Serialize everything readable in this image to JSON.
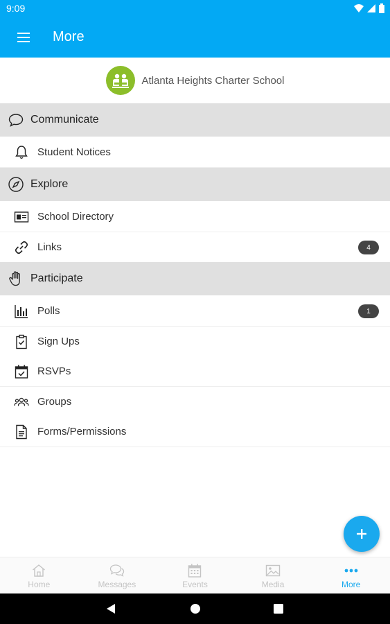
{
  "status_bar": {
    "time": "9:09"
  },
  "app_bar": {
    "title": "More"
  },
  "school": {
    "name": "Atlanta Heights Charter School",
    "logo_color": "#8cbe2a"
  },
  "sections": {
    "communicate": {
      "label": "Communicate",
      "items": [
        {
          "label": "Student Notices"
        }
      ]
    },
    "explore": {
      "label": "Explore",
      "items": [
        {
          "label": "School Directory"
        },
        {
          "label": "Links",
          "badge": "4"
        }
      ]
    },
    "participate": {
      "label": "Participate",
      "items": [
        {
          "label": "Polls",
          "badge": "1"
        },
        {
          "label": "Sign Ups"
        },
        {
          "label": "RSVPs"
        },
        {
          "label": "Groups"
        },
        {
          "label": "Forms/Permissions"
        }
      ]
    }
  },
  "bottom_nav": {
    "items": [
      {
        "label": "Home",
        "icon": "home-icon"
      },
      {
        "label": "Messages",
        "icon": "messages-icon"
      },
      {
        "label": "Events",
        "icon": "calendar-icon"
      },
      {
        "label": "Media",
        "icon": "image-icon"
      },
      {
        "label": "More",
        "icon": "more-dots-icon",
        "active": true
      }
    ]
  },
  "colors": {
    "primary": "#03a9f4",
    "accent": "#1aa9ee",
    "section_bg": "#e0e0e0",
    "badge_bg": "#444444"
  }
}
